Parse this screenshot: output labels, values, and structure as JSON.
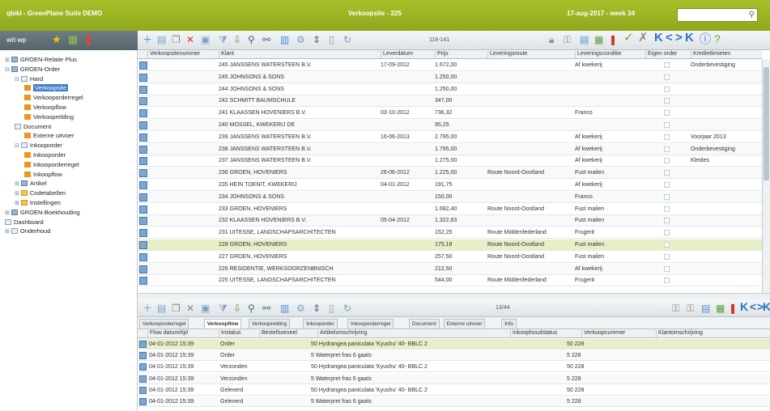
{
  "titlebar": {
    "left": "qbikl - GreenPlane Suite DEMO",
    "center": "Verkoopsite - 225",
    "right": "17-aug-2017 - week 34",
    "search_placeholder": ""
  },
  "left_toolbar": {
    "text": "wit wp"
  },
  "tree": [
    {
      "label": "GROEN-Relatie Plus",
      "indent": 0,
      "icon": "grid",
      "toggle": "+"
    },
    {
      "label": "GROEN-Order",
      "indent": 0,
      "icon": "grid",
      "toggle": "-"
    },
    {
      "label": "Hard",
      "indent": 1,
      "icon": "doc",
      "toggle": "-"
    },
    {
      "label": "Verkoopsite",
      "indent": 2,
      "icon": "orange",
      "selected": true
    },
    {
      "label": "Verkooporderregel",
      "indent": 2,
      "icon": "orange"
    },
    {
      "label": "Verkoopflow",
      "indent": 2,
      "icon": "orange"
    },
    {
      "label": "Verkooprelding",
      "indent": 2,
      "icon": "orange"
    },
    {
      "label": "Document",
      "indent": 1,
      "icon": "doc"
    },
    {
      "label": "Externe uitvoer",
      "indent": 2,
      "icon": "orange"
    },
    {
      "label": "Inkooporder",
      "indent": 1,
      "icon": "doc",
      "toggle": "-"
    },
    {
      "label": "Inkooporder",
      "indent": 2,
      "icon": "orange"
    },
    {
      "label": "Inkooporderregel",
      "indent": 2,
      "icon": "orange"
    },
    {
      "label": "Inkoopflow",
      "indent": 2,
      "icon": "orange"
    },
    {
      "label": "Artikel",
      "indent": 1,
      "icon": "grid",
      "toggle": "+"
    },
    {
      "label": "Codetabellen",
      "indent": 1,
      "icon": "folder",
      "toggle": "+"
    },
    {
      "label": "Instellingen",
      "indent": 1,
      "icon": "folder",
      "toggle": "+"
    },
    {
      "label": "GROEN-Boekhouding",
      "indent": 0,
      "icon": "grid",
      "toggle": "+"
    },
    {
      "label": "Dashboard",
      "indent": 0,
      "icon": "doc"
    },
    {
      "label": "Onderhoud",
      "indent": 0,
      "icon": "doc",
      "toggle": "+"
    }
  ],
  "main_toolbar": {
    "page_text": "116-141"
  },
  "grid": {
    "headers": [
      "Verkoopsitenummer",
      "Klant",
      "Leverdatum",
      "Prijs",
      "Leveringsroute",
      "Leveringsconditie",
      "Eigen order",
      "Kredietlimieten"
    ],
    "rows": [
      {
        "klant": "245 JANSSENS WATERSTEEN B.V.",
        "leverdatum": "17-09-2012",
        "prijs": "1.672,00",
        "route": "",
        "conditie": "Af kwekerij",
        "krediet": "Onderbevestiging"
      },
      {
        "klant": "245 JOHNSONS & SONS",
        "leverdatum": "",
        "prijs": "1.250,00",
        "route": "",
        "conditie": "",
        "krediet": ""
      },
      {
        "klant": "244 JOHNSONS & SONS",
        "leverdatum": "",
        "prijs": "1.250,00",
        "route": "",
        "conditie": "",
        "krediet": ""
      },
      {
        "klant": "242 SCHMITT BAUMSCHULE",
        "leverdatum": "",
        "prijs": "347,00",
        "route": "",
        "conditie": "",
        "krediet": ""
      },
      {
        "klant": "241 KLAASSEN HOVENIERS B.V.",
        "leverdatum": "03-10-2012",
        "prijs": "736,32",
        "route": "",
        "conditie": "Franco",
        "krediet": ""
      },
      {
        "klant": "240 MOSSEL, KWEKERIJ DE",
        "leverdatum": "",
        "prijs": "95,25",
        "route": "",
        "conditie": "",
        "krediet": ""
      },
      {
        "klant": "239 JANSSENS WATERSTEEN B.V.",
        "leverdatum": "16-06-2013",
        "prijs": "2.795,00",
        "route": "",
        "conditie": "Af kwekerij",
        "krediet": "Voorjaar 2013"
      },
      {
        "klant": "238 JANSSENS WATERSTEEN B.V.",
        "leverdatum": "",
        "prijs": "1.795,00",
        "route": "",
        "conditie": "Af kwekerij",
        "krediet": "Onderbevestiging"
      },
      {
        "klant": "237 JANSSENS WATERSTEEN B.V.",
        "leverdatum": "",
        "prijs": "1.275,00",
        "route": "",
        "conditie": "Af kwekerij",
        "krediet": "Kleides"
      },
      {
        "klant": "236 GROEN, HOVENIERS",
        "leverdatum": "26-06-2012",
        "prijs": "1.225,00",
        "route": "Route Noord-Oostland",
        "conditie": "Fust mailen",
        "krediet": ""
      },
      {
        "klant": "235 HEIN TOENIT, KWEKERIJ",
        "leverdatum": "04-01-2012",
        "prijs": "191,75",
        "route": "",
        "conditie": "Af kwekerij",
        "krediet": ""
      },
      {
        "klant": "234 JOHNSONS & SONS",
        "leverdatum": "",
        "prijs": "150,00",
        "route": "",
        "conditie": "Franco",
        "krediet": ""
      },
      {
        "klant": "233 GROEN, HOVENIERS",
        "leverdatum": "",
        "prijs": "1.682,40",
        "route": "Route Noord-Oostland",
        "conditie": "Fust mailen",
        "krediet": ""
      },
      {
        "klant": "232 KLAASSEN HOVENIERS B.V.",
        "leverdatum": "05-04-2012",
        "prijs": "1.322,83",
        "route": "",
        "conditie": "Fust mailen",
        "krediet": ""
      },
      {
        "klant": "231 UITESSE, LANDSCHAPSARCHITECTEN",
        "leverdatum": "",
        "prijs": "152,25",
        "route": "Route Middenfederland",
        "conditie": "Frugerit",
        "krediet": ""
      },
      {
        "klant": "228 GROEN, HOVENIERS",
        "leverdatum": "",
        "prijs": "175,18",
        "route": "Route Noord-Oostland",
        "conditie": "Fust mailen",
        "krediet": "",
        "highlight": true
      },
      {
        "klant": "227 GROEN, HOVENIERS",
        "leverdatum": "",
        "prijs": "257,50",
        "route": "Route Noord-Oostland",
        "conditie": "Fust mailen",
        "krediet": ""
      },
      {
        "klant": "226 RESIDENTIE, WERKSOORZENBNISCH",
        "leverdatum": "",
        "prijs": "212,50",
        "route": "",
        "conditie": "Af kwekerij",
        "krediet": ""
      },
      {
        "klant": "225 UITESSE, LANDSCHAPSARCHITECTEN",
        "leverdatum": "",
        "prijs": "544,00",
        "route": "Route Middenfederland",
        "conditie": "Frugerit",
        "krediet": ""
      }
    ]
  },
  "bottom_toolbar": {
    "page_text": "13/44"
  },
  "tabs": [
    "Verkooporderregel",
    "Verkoopflow",
    "Verkooprelding",
    "Inkooporder",
    "Inkooporderregel",
    "Document",
    "Externe uitvoer",
    "Info"
  ],
  "active_tab": 1,
  "detail": {
    "headers": [
      "Flow datum/tijd",
      "Instatus",
      "Bestelhoeveel",
      "Artikelomschrijving",
      "Inkoophoudstatus",
      "Verkoopnummer",
      "Klantomschrijving"
    ],
    "rows": [
      {
        "datum": "04-01-2012 15:39",
        "status": "Order",
        "omschrijving": "50 Hydrangea paniculata 'Kyushu' 40- BBLC 2",
        "nr": "50 228",
        "highlight": true
      },
      {
        "datum": "04-01-2012 15:39",
        "status": "Order",
        "omschrijving": "5 Waterpret fras 6 gaats",
        "nr": "5 228"
      },
      {
        "datum": "04-01-2012 15:39",
        "status": "Verzonden",
        "omschrijving": "50 Hydrangea paniculata 'Kyushu' 40- BBLC 2",
        "nr": "50 228"
      },
      {
        "datum": "04-01-2012 15:39",
        "status": "Verzonden",
        "omschrijving": "5 Waterpret fras 6 gaats",
        "nr": "5 228"
      },
      {
        "datum": "04-01-2012 15:39",
        "status": "Geleverd",
        "omschrijving": "50 Hydrangea paniculata 'Kyushu' 40- BBLC 2",
        "nr": "50 228"
      },
      {
        "datum": "04-01-2012 15:39",
        "status": "Geleverd",
        "omschrijving": "5 Waterpret fras 6 gaats",
        "nr": "5 228"
      }
    ]
  },
  "colors": {
    "accent": "#9cb423",
    "highlight": "#e6efc7",
    "selection": "#3d7ecb"
  }
}
